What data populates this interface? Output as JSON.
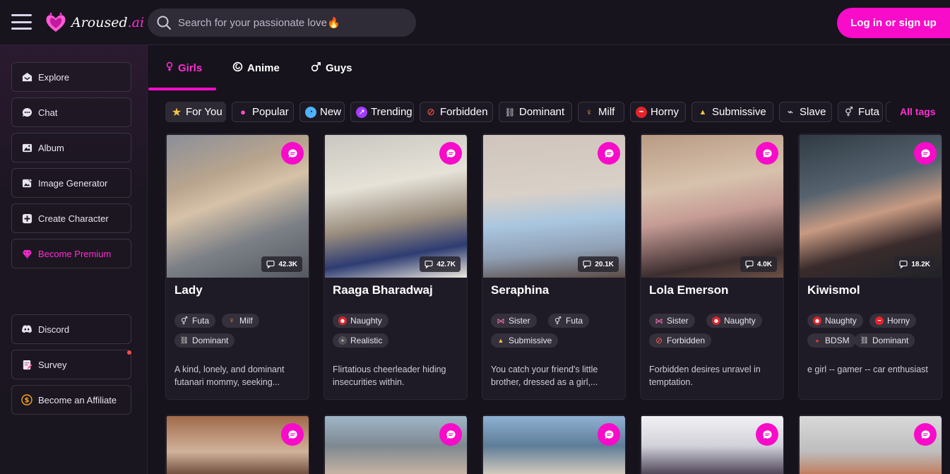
{
  "brand": {
    "name": "Aroused",
    "suffix": ".ai"
  },
  "search": {
    "placeholder": "Search for your passionate love🔥"
  },
  "header": {
    "login_label": "Log in or sign up"
  },
  "sidebar": {
    "items": [
      {
        "label": "Explore",
        "icon": "explore-icon"
      },
      {
        "label": "Chat",
        "icon": "chat-icon"
      },
      {
        "label": "Album",
        "icon": "album-icon"
      },
      {
        "label": "Image Generator",
        "icon": "image-generator-icon"
      },
      {
        "label": "Create Character",
        "icon": "plus-icon"
      },
      {
        "label": "Become Premium",
        "icon": "diamond-icon"
      }
    ],
    "bottom_items": [
      {
        "label": "Discord",
        "icon": "discord-icon"
      },
      {
        "label": "Survey",
        "icon": "survey-icon"
      },
      {
        "label": "Become an Affiliate",
        "icon": "dollar-icon"
      }
    ]
  },
  "tabs": [
    {
      "label": "Girls",
      "icon": "female-icon",
      "active": true
    },
    {
      "label": "Anime",
      "icon": "anime-icon",
      "active": false
    },
    {
      "label": "Guys",
      "icon": "male-icon",
      "active": false
    }
  ],
  "tags": [
    {
      "label": "For You",
      "icon": "star-icon",
      "active": true
    },
    {
      "label": "Popular",
      "icon": "fire-drop-icon"
    },
    {
      "label": "New",
      "icon": "clock-icon"
    },
    {
      "label": "Trending",
      "icon": "trend-icon"
    },
    {
      "label": "Forbidden",
      "icon": "no-entry-icon"
    },
    {
      "label": "Dominant",
      "icon": "chain-icon"
    },
    {
      "label": "Milf",
      "icon": "woman-icon"
    },
    {
      "label": "Horny",
      "icon": "lips-icon"
    },
    {
      "label": "Submissive",
      "icon": "kneel-icon"
    },
    {
      "label": "Slave",
      "icon": "link-icon"
    },
    {
      "label": "Futa",
      "icon": "futa-icon"
    }
  ],
  "all_tags_label": "All tags",
  "cards": [
    {
      "name": "Lady",
      "views": "42.3K",
      "chips": [
        [
          "Futa",
          "futa-icon"
        ],
        [
          "Milf",
          "woman-icon"
        ],
        [
          "Dominant",
          "chain-icon"
        ]
      ],
      "desc": "A kind, lonely, and dominant futanari mommy, seeking..."
    },
    {
      "name": "Raaga Bharadwaj",
      "views": "42.7K",
      "chips": [
        [
          "Naughty",
          "devil-icon"
        ],
        [
          "Realistic",
          "person-icon"
        ]
      ],
      "desc": "Flirtatious cheerleader hiding insecurities within."
    },
    {
      "name": "Seraphina",
      "views": "20.1K",
      "chips": [
        [
          "Sister",
          "bow-icon"
        ],
        [
          "Futa",
          "futa-icon"
        ],
        [
          "Submissive",
          "kneel-icon"
        ]
      ],
      "desc": "You catch your friend's little brother, dressed as a girl,..."
    },
    {
      "name": "Lola Emerson",
      "views": "4.0K",
      "chips": [
        [
          "Sister",
          "bow-icon"
        ],
        [
          "Naughty",
          "devil-icon"
        ],
        [
          "Forbidden",
          "no-entry-icon"
        ]
      ],
      "desc": "Forbidden desires unravel in temptation."
    },
    {
      "name": "Kiwismol",
      "views": "18.2K",
      "chips": [
        [
          "Naughty",
          "devil-icon"
        ],
        [
          "Horny",
          "lips-icon"
        ],
        [
          "BDSM",
          "drop-icon"
        ],
        [
          "Dominant",
          "chain-icon"
        ]
      ],
      "desc": "e girl -- gamer -- car enthusiast"
    }
  ],
  "colors": {
    "accent": "#f80bc9",
    "accent_text": "#ff2fd0",
    "bg": "#16131d",
    "card": "#1f1b26"
  }
}
